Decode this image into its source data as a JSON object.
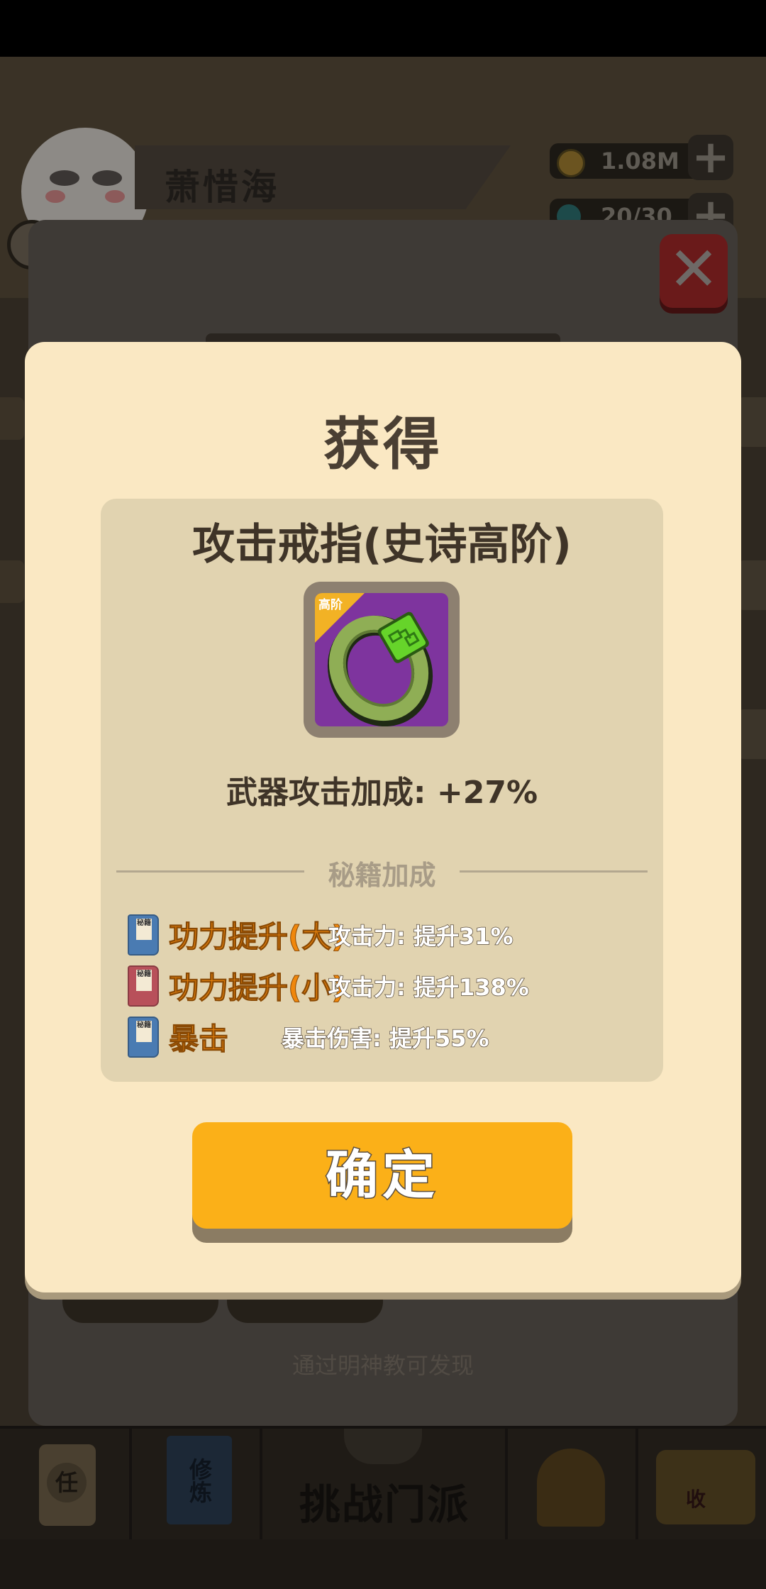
{
  "player": {
    "name": "萧惜海"
  },
  "resources": {
    "coins": "1.08M",
    "energy": "20/30"
  },
  "background": {
    "hint": "通过明神教可发现"
  },
  "bottom_nav": {
    "task_label": "任",
    "cultivate_label": "修炼",
    "challenge_label": "挑战门派",
    "house_label": "收"
  },
  "modal": {
    "title": "获得",
    "item_name": "攻击戒指(史诗高阶)",
    "tier_badge": "高阶",
    "item_stat": "武器攻击加成: +27%",
    "section_title": "秘籍加成",
    "skills": [
      {
        "book_tag": "秘籍",
        "name": "功力提升(大)",
        "effect": "攻击力: 提升31%",
        "book_color": "#4a7bb2"
      },
      {
        "book_tag": "秘籍",
        "name": "功力提升(小)",
        "effect": "攻击力: 提升138%",
        "book_color": "#b8505a"
      },
      {
        "book_tag": "秘籍",
        "name": "暴击",
        "effect": "暴击伤害: 提升55%",
        "book_color": "#4a7bb2"
      }
    ],
    "confirm_label": "确定"
  }
}
